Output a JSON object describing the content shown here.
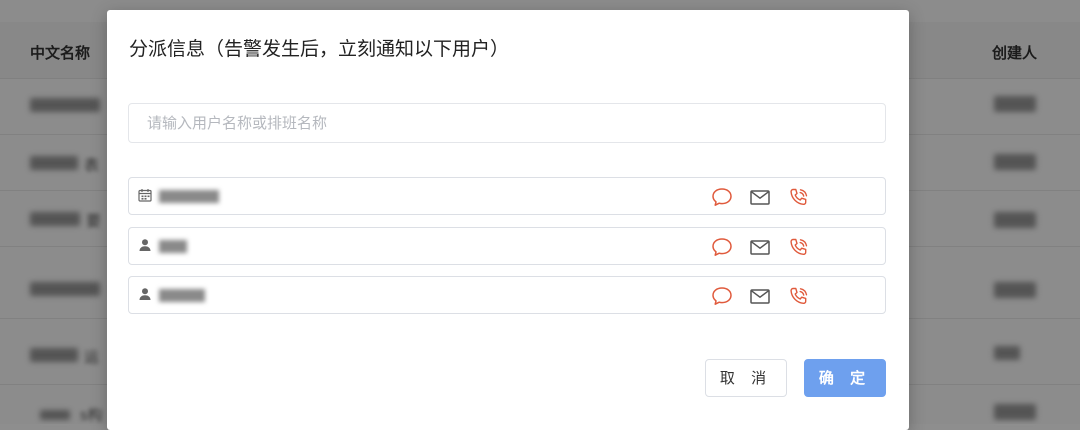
{
  "background": {
    "columns": {
      "chinese_name": "中文名称",
      "creator": "创建人"
    },
    "row_fragments": [
      "表",
      "要",
      "运",
      "s构"
    ]
  },
  "dialog": {
    "title": "分派信息（告警发生后，立刻通知以下用户）",
    "search": {
      "placeholder": "请输入用户名称或排班名称",
      "value": ""
    },
    "recipients": [
      {
        "type": "schedule",
        "icon": "calendar-icon",
        "name": ""
      },
      {
        "type": "user",
        "icon": "user-icon",
        "name": ""
      },
      {
        "type": "user",
        "icon": "user-icon",
        "name": ""
      }
    ],
    "buttons": {
      "cancel": "取 消",
      "confirm": "确 定"
    }
  },
  "colors": {
    "action_icon": "#e05a3c",
    "mail_icon": "#555555",
    "primary_button": "#6ea0ee",
    "overlay": "rgba(0,0,0,0.45)"
  }
}
